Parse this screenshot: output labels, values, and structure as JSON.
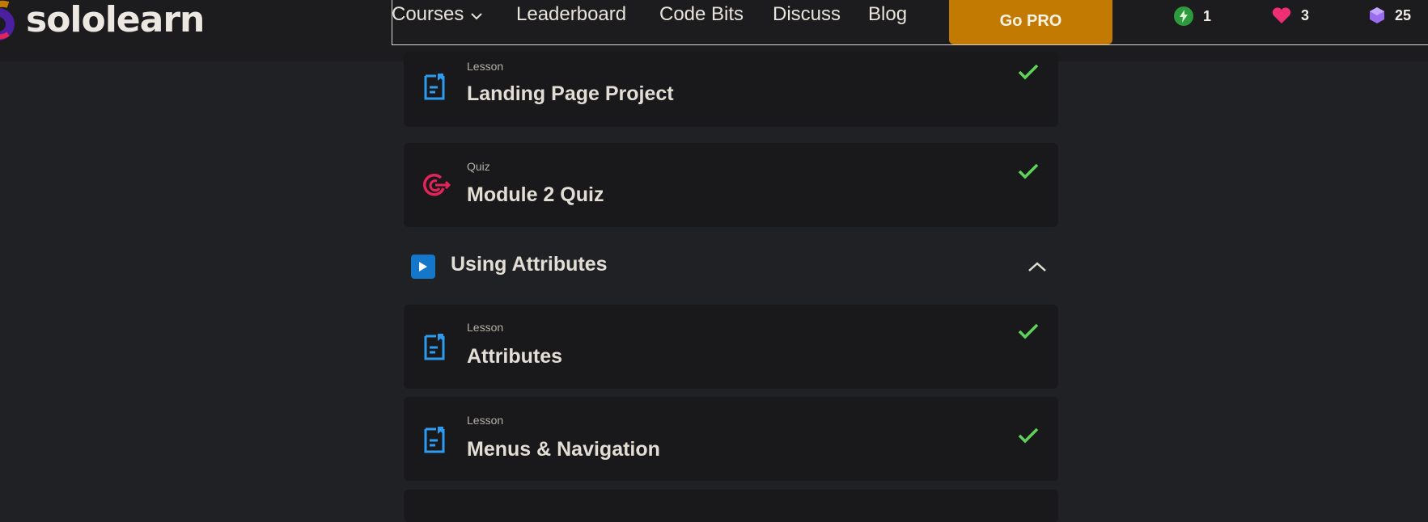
{
  "brand": {
    "name": "sololearn"
  },
  "nav": {
    "courses": "Courses",
    "leaderboard": "Leaderboard",
    "code_bits": "Code Bits",
    "discuss": "Discuss",
    "blog": "Blog",
    "go_pro": "Go PRO"
  },
  "stats": {
    "streak": "1",
    "hearts": "3",
    "gems": "25"
  },
  "items": [
    {
      "kind": "Lesson",
      "title": "Landing Page Project",
      "icon": "lesson-icon",
      "completed": true
    },
    {
      "kind": "Quiz",
      "title": "Module 2 Quiz",
      "icon": "quiz-target-icon",
      "completed": true
    }
  ],
  "section": {
    "title": "Using Attributes",
    "expanded": true
  },
  "section_items": [
    {
      "kind": "Lesson",
      "title": "Attributes",
      "icon": "lesson-icon",
      "completed": true
    },
    {
      "kind": "Lesson",
      "title": "Menus & Navigation",
      "icon": "lesson-icon",
      "completed": true
    }
  ],
  "colors": {
    "background": "#202124",
    "card": "#19191b",
    "accent_pro": "#c27a02",
    "check": "#5ed35a",
    "lesson_icon": "#2d9bf0",
    "quiz_icon": "#e3245a",
    "play": "#1477c9"
  }
}
